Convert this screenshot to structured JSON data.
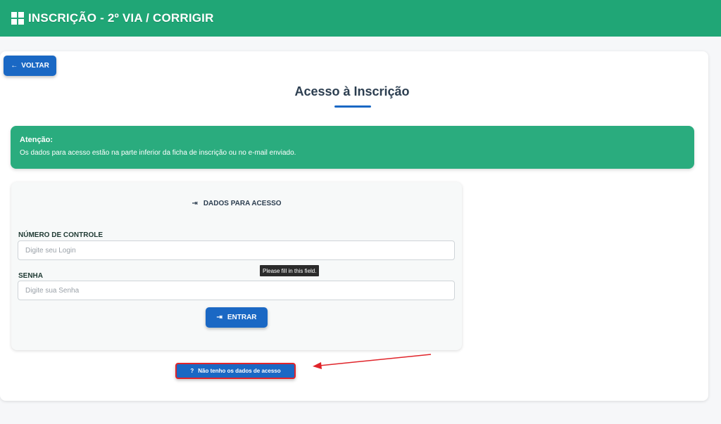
{
  "header": {
    "title": "INSCRIÇÃO - 2º VIA / CORRIGIR",
    "icon": "grid-icon",
    "color": "#20a676"
  },
  "back_button": {
    "label": "VOLTAR",
    "icon": "←"
  },
  "page": {
    "title": "Acesso à Inscrição",
    "accent": "#1a68c4"
  },
  "alert": {
    "title": "Atenção:",
    "text": "Os dados para acesso estão na parte inferior da ficha de inscrição ou no e-mail enviado.",
    "color": "#2aac7e"
  },
  "form": {
    "section_title": "DADOS PARA ACESSO",
    "section_icon": "login-icon",
    "login_label": "NÚMERO DE CONTROLE",
    "login_placeholder": "Digite seu Login",
    "login_value": "",
    "password_label": "SENHA",
    "password_placeholder": "Digite sua Senha",
    "password_value": "",
    "tooltip": "Please fill in this field.",
    "submit_label": "ENTRAR",
    "submit_icon": "⇥"
  },
  "no_data_button": {
    "label": "Não tenho os dados de acesso",
    "icon": "?"
  },
  "annotation": {
    "highlight_color": "#e0242a"
  }
}
